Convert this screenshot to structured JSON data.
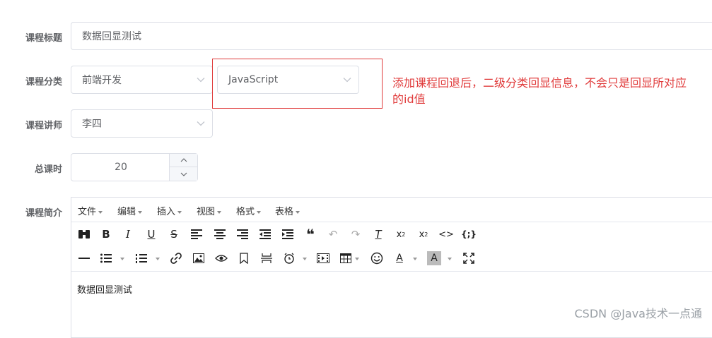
{
  "form": {
    "title_label": "课程标题",
    "title_value": "数据回显测试",
    "category_label": "课程分类",
    "category_primary": "前端开发",
    "category_secondary": "JavaScript",
    "teacher_label": "课程讲师",
    "teacher_value": "李四",
    "hours_label": "总课时",
    "hours_value": "20",
    "intro_label": "课程简介"
  },
  "annotation": {
    "note": "添加课程回退后，二级分类回显信息，不会只是回显所对应的id值",
    "frame_color": "#e03b3b"
  },
  "editor": {
    "menus": [
      "文件",
      "编辑",
      "插入",
      "视图",
      "格式",
      "表格"
    ],
    "content": "数据回显测试",
    "toolbar_row1": [
      "binoculars-icon",
      "bold-icon",
      "italic-icon",
      "underline-icon",
      "strikethrough-icon",
      "align-left-icon",
      "align-center-icon",
      "align-right-icon",
      "outdent-icon",
      "indent-icon",
      "blockquote-icon",
      "undo-icon",
      "redo-icon",
      "clear-format-icon",
      "subscript-icon",
      "superscript-icon",
      "code-icon",
      "code-block-icon"
    ],
    "toolbar_row2": [
      "horizontal-rule-icon",
      "bullet-list-icon",
      "numbered-list-icon",
      "link-icon",
      "image-icon",
      "preview-icon",
      "bookmark-icon",
      "page-break-icon",
      "time-icon",
      "media-icon",
      "table-icon",
      "emoticon-icon",
      "text-color-icon",
      "background-color-icon",
      "fullscreen-icon"
    ]
  },
  "watermark": "CSDN @Java技术一点通"
}
